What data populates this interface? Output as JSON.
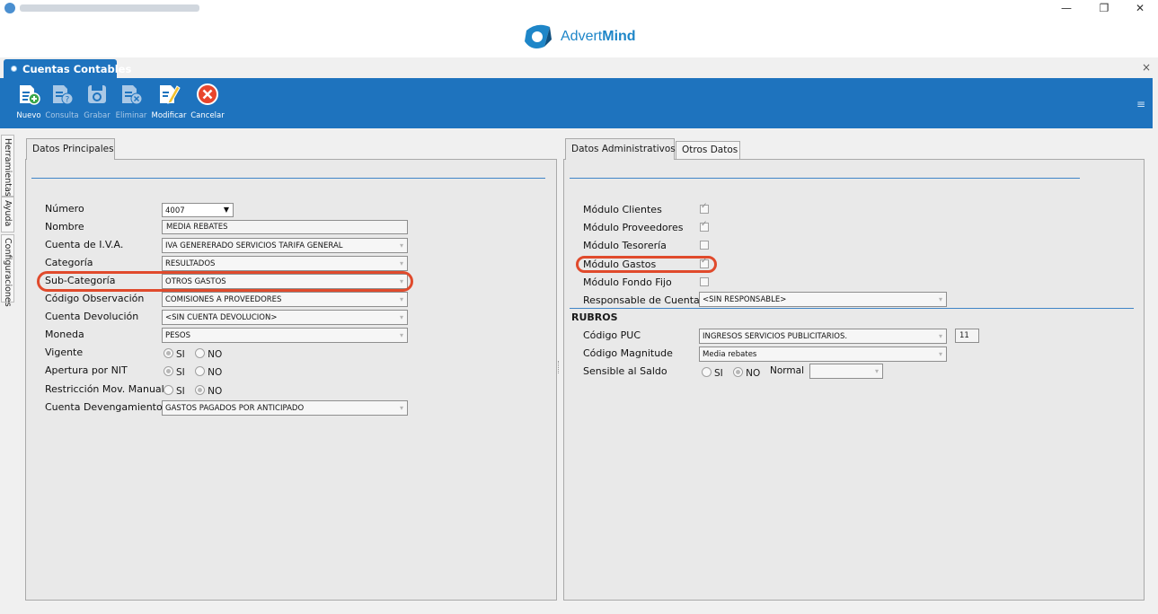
{
  "app": {
    "title_blurred": "",
    "logo": {
      "part1": "Advert",
      "part2": "Mind"
    },
    "window_controls": {
      "minimize": "—",
      "restore": "❐",
      "close": "✕"
    }
  },
  "doc_tab": {
    "label": "Cuentas Contables",
    "close": "×"
  },
  "toolbar": {
    "menu_icon": "≡",
    "buttons": [
      {
        "label": "Nuevo",
        "icon": "new-doc-icon",
        "enabled": true
      },
      {
        "label": "Consulta",
        "icon": "query-doc-icon",
        "enabled": false
      },
      {
        "label": "Grabar",
        "icon": "save-icon",
        "enabled": false
      },
      {
        "label": "Eliminar",
        "icon": "delete-doc-icon",
        "enabled": false
      },
      {
        "label": "Modificar",
        "icon": "edit-icon",
        "enabled": true
      },
      {
        "label": "Cancelar",
        "icon": "cancel-icon",
        "enabled": true
      }
    ]
  },
  "side_tabs": [
    "Herramientas",
    "Ayuda",
    "Configuraciones"
  ],
  "left_panel": {
    "tab": "Datos Principales",
    "fields": {
      "numero": {
        "label": "Número",
        "value": "4007"
      },
      "nombre": {
        "label": "Nombre",
        "value": "MEDIA REBATES"
      },
      "cuenta_iva": {
        "label": "Cuenta de I.V.A.",
        "value": "IVA GENERERADO SERVICIOS TARIFA GENERAL"
      },
      "categoria": {
        "label": "Categoría",
        "value": "RESULTADOS"
      },
      "sub_categoria": {
        "label": "Sub-Categoría",
        "value": "OTROS GASTOS"
      },
      "codigo_observacion": {
        "label": "Código Observación",
        "value": "COMISIONES A PROVEEDORES"
      },
      "cuenta_devolucion": {
        "label": "Cuenta Devolución",
        "value": "<SIN CUENTA DEVOLUCION>"
      },
      "moneda": {
        "label": "Moneda",
        "value": "PESOS"
      },
      "vigente": {
        "label": "Vigente",
        "selected": "SI"
      },
      "apertura_nit": {
        "label": "Apertura por NIT",
        "selected": "SI"
      },
      "restriccion": {
        "label": "Restricción Mov. Manual",
        "selected": "NO"
      },
      "cuenta_devengamiento": {
        "label": "Cuenta Devengamiento",
        "value": "GASTOS PAGADOS POR ANTICIPADO"
      }
    },
    "radio_si": "SI",
    "radio_no": "NO"
  },
  "right_panel": {
    "tabs": [
      "Datos Administrativos",
      "Otros Datos"
    ],
    "modulos": [
      {
        "label": "Módulo Clientes",
        "checked": true
      },
      {
        "label": "Módulo Proveedores",
        "checked": true
      },
      {
        "label": "Módulo Tesorería",
        "checked": false
      },
      {
        "label": "Módulo Gastos",
        "checked": true
      },
      {
        "label": "Módulo Fondo Fijo",
        "checked": false
      }
    ],
    "responsable": {
      "label": "Responsable de Cuenta",
      "value": "<SIN RESPONSABLE>"
    },
    "rubros_title": "RUBROS",
    "codigo_puc": {
      "label": "Código PUC",
      "value": "INGRESOS SERVICIOS PUBLICITARIOS.",
      "code": "11"
    },
    "codigo_magnitude": {
      "label": "Código Magnitude",
      "value": "Media rebates"
    },
    "sensible_saldo": {
      "label": "Sensible al Saldo",
      "selected": "NO",
      "normal_label": "Normal",
      "normal_value": ""
    },
    "radio_si": "SI",
    "radio_no": "NO"
  },
  "colors": {
    "toolbar_bg": "#1e73be",
    "highlight": "#e04a2c",
    "separator": "#3f85c7"
  }
}
